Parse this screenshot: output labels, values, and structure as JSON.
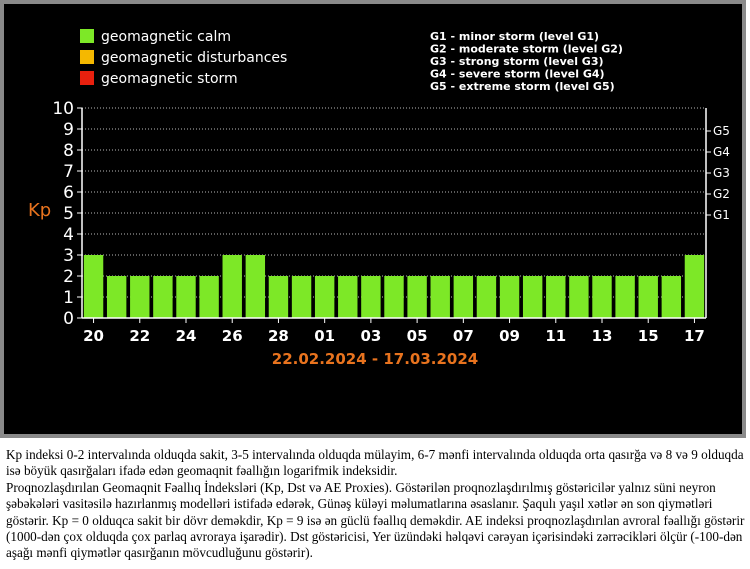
{
  "chart_data": {
    "type": "bar",
    "ylabel": "Kp",
    "ylim": [
      0,
      10
    ],
    "yticks": [
      "0",
      "1",
      "2",
      "3",
      "4",
      "5",
      "6",
      "7",
      "8",
      "9",
      "10"
    ],
    "g_ticks": [
      {
        "label": "G1",
        "value": 5
      },
      {
        "label": "G2",
        "value": 6
      },
      {
        "label": "G3",
        "value": 7
      },
      {
        "label": "G4",
        "value": 8
      },
      {
        "label": "G5",
        "value": 9
      }
    ],
    "x_tick_labels": [
      "20",
      "22",
      "24",
      "26",
      "28",
      "01",
      "03",
      "05",
      "07",
      "09",
      "11",
      "13",
      "15",
      "17"
    ],
    "values": [
      3,
      2,
      2,
      2,
      2,
      2,
      3,
      3,
      2,
      2,
      2,
      2,
      2,
      2,
      2,
      2,
      2,
      2,
      2,
      2,
      2,
      2,
      2,
      2,
      2,
      2,
      3
    ],
    "bar_color": "#7de827",
    "date_range": "22.02.2024 - 17.03.2024",
    "legend": [
      {
        "label": "geomagnetic calm",
        "color": "#7de827"
      },
      {
        "label": "geomagnetic disturbances",
        "color": "#f5b800"
      },
      {
        "label": "geomagnetic storm",
        "color": "#e8200e"
      }
    ],
    "storm_levels": [
      "G1 - minor storm (level G1)",
      "G2 - moderate storm (level G2)",
      "G3 - strong storm (level G3)",
      "G4 - severe storm (level G4)",
      "G5 - extreme storm (level G5)"
    ],
    "grid": true
  },
  "description": {
    "p1": "Kp indeksi 0-2 intervalında olduqda sakit, 3-5 intervalında olduqda mülayim, 6-7 mənfi intervalında olduqda orta qasırğa və 8 və 9 olduqda isə böyük qasırğaları ifadə edən geomaqnit fəallığın logarifmik indeksidir.",
    "p2": "Proqnozlaşdırılan Geomaqnit Fəallıq İndeksləri (Kp, Dst və AE Proxies). Göstərilən proqnozlaşdırılmış göstəricilər yalnız süni neyron şəbəkələri vasitəsilə hazırlanmış modelləri istifadə edərək, Günəş küləyi məlumatlarına əsaslanır. Şaqulı yaşıl xətlər ən son qiymətləri göstərir. Kp = 0 olduqca sakit bir dövr deməkdir, Kp = 9 isə ən güclü fəallıq deməkdir. AE indeksi proqnozlaşdırılan avroral fəallığı göstərir (1000-dən çox olduqda çox parlaq avroraya işarədir). Dst göstəricisi, Yer üzündəki həlqəvi cərəyan içərisindəki zərrəcikləri ölçür (-100-dən aşağı mənfi qiymətlər qasırğanın mövcudluğunu göstərir)."
  }
}
